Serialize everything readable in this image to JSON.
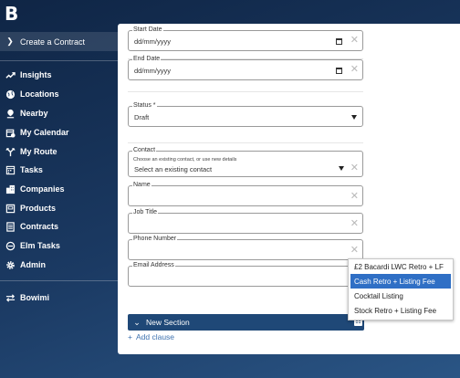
{
  "app": {
    "logo": "B"
  },
  "sidebar": {
    "active": {
      "label": "Create a Contract"
    },
    "items": [
      {
        "label": "Insights",
        "icon": "trend-up-icon"
      },
      {
        "label": "Locations",
        "icon": "globe-icon"
      },
      {
        "label": "Nearby",
        "icon": "map-pin-icon"
      },
      {
        "label": "My Calendar",
        "icon": "calendar-icon"
      },
      {
        "label": "My Route",
        "icon": "route-icon"
      },
      {
        "label": "Tasks",
        "icon": "tasks-icon"
      },
      {
        "label": "Companies",
        "icon": "building-icon"
      },
      {
        "label": "Products",
        "icon": "products-icon"
      },
      {
        "label": "Contracts",
        "icon": "contract-icon"
      },
      {
        "label": "Elm Tasks",
        "icon": "elm-icon"
      },
      {
        "label": "Admin",
        "icon": "gear-icon"
      }
    ],
    "footer": {
      "label": "Bowimi",
      "icon": "switch-icon"
    }
  },
  "form": {
    "start_date": {
      "label": "Start Date",
      "value": "dd/mm/yyyy"
    },
    "end_date": {
      "label": "End Date",
      "value": "dd/mm/yyyy"
    },
    "status": {
      "label": "Status *",
      "value": "Draft"
    },
    "contact": {
      "label": "Contact",
      "hint": "Choose an existing contact, or use new details",
      "value": "Select an existing contact"
    },
    "name": {
      "label": "Name",
      "value": ""
    },
    "job_title": {
      "label": "Job Title",
      "value": ""
    },
    "phone": {
      "label": "Phone Number",
      "value": ""
    },
    "email": {
      "label": "Email Address",
      "value": ""
    }
  },
  "section": {
    "title": "New Section",
    "add_clause": "Add clause"
  },
  "dropdown": {
    "options": [
      "£2 Bacardi LWC Retro + LF",
      "Cash Retro + Listing Fee",
      "Cocktail Listing",
      "Stock Retro + Listing Fee"
    ],
    "selected": "Cash Retro + Listing Fee"
  },
  "colors": {
    "accent": "#2f6fc5",
    "section_bar": "#1f4877",
    "link": "#3f73b0"
  }
}
